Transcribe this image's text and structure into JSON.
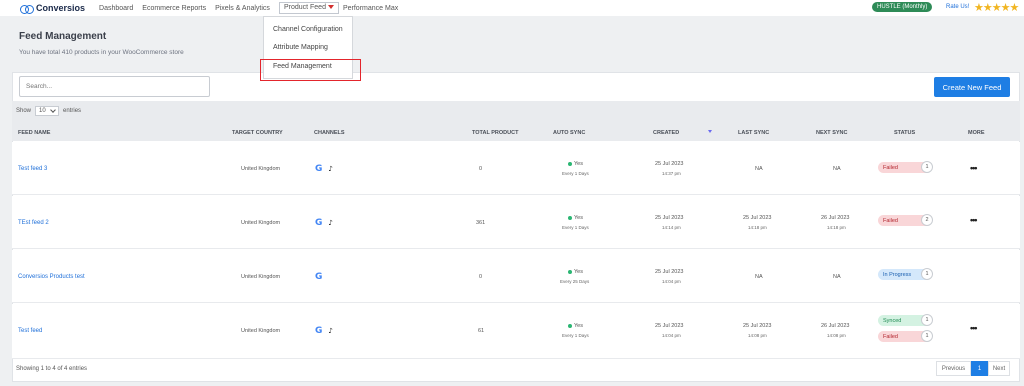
{
  "nav": {
    "brand": "Conversios",
    "items": [
      "Dashboard",
      "Ecommerce Reports",
      "Pixels & Analytics",
      "Product Feed",
      "Performance Max"
    ],
    "plan": "HUSTLE (Monthly)",
    "rate": "Rate Us!",
    "stars": "★★★★★"
  },
  "dropdown": {
    "items": [
      "Channel Configuration",
      "Attribute Mapping",
      "Feed Management"
    ]
  },
  "header": {
    "title": "Feed Management",
    "subtitle": "You have total 410 products in your WooCommerce store"
  },
  "toolbar": {
    "search_placeholder": "Search...",
    "create_label": "Create New Feed",
    "show_label": "Show",
    "show_value": "10",
    "entries_label": "entries"
  },
  "columns": [
    "FEED NAME",
    "TARGET COUNTRY",
    "CHANNELS",
    "TOTAL PRODUCT",
    "AUTO SYNC",
    "CREATED",
    "LAST SYNC",
    "NEXT SYNC",
    "STATUS",
    "MORE"
  ],
  "rows": [
    {
      "name": "Test feed 3",
      "country": "United Kingdom",
      "total": "0",
      "sync": "Yes",
      "every": "Every 1 Days",
      "created_date": "25 Jul 2023",
      "created_time": "14:37 pm",
      "last": "NA",
      "last_time": "",
      "next": "NA",
      "next_time": "",
      "status1": "Failed",
      "count1": "1",
      "status2": "",
      "count2": ""
    },
    {
      "name": "TEst feed 2",
      "country": "United Kingdom",
      "total": "361",
      "sync": "Yes",
      "every": "Every 1 Days",
      "created_date": "25 Jul 2023",
      "created_time": "14:14 pm",
      "last": "25 Jul 2023",
      "last_time": "14:18 pm",
      "next": "26 Jul 2023",
      "next_time": "14:18 pm",
      "status1": "Failed",
      "count1": "2",
      "status2": "",
      "count2": ""
    },
    {
      "name": "Conversios Products test",
      "country": "United Kingdom",
      "total": "0",
      "sync": "Yes",
      "every": "Every 25 Days",
      "created_date": "25 Jul 2023",
      "created_time": "14:04 pm",
      "last": "NA",
      "last_time": "",
      "next": "NA",
      "next_time": "",
      "status1": "In Progress",
      "count1": "1",
      "status2": "",
      "count2": ""
    },
    {
      "name": "Test feed",
      "country": "United Kingdom",
      "total": "61",
      "sync": "Yes",
      "every": "Every 1 Days",
      "created_date": "25 Jul 2023",
      "created_time": "14:04 pm",
      "last": "25 Jul 2023",
      "last_time": "14:08 pm",
      "next": "26 Jul 2023",
      "next_time": "14:08 pm",
      "status1": "Synced",
      "count1": "1",
      "status2": "Failed",
      "count2": "1"
    }
  ],
  "footer": {
    "info": "Showing 1 to 4 of 4 entries",
    "prev": "Previous",
    "page": "1",
    "next": "Next"
  },
  "icons": {
    "google": "G",
    "tiktok": "♪",
    "more": "•••"
  }
}
